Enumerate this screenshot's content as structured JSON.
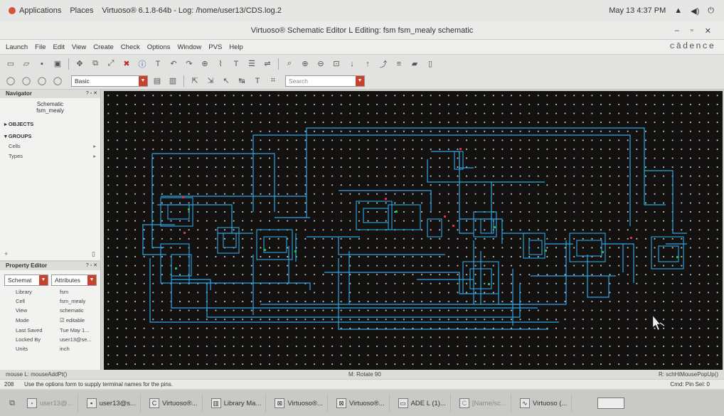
{
  "topbar": {
    "applications": "Applications",
    "places": "Places",
    "app_title": "Virtuoso® 6.1.8-64b - Log: /home/user13/CDS.log.2",
    "clock": "May 13  4:37 PM"
  },
  "window": {
    "title": "Virtuoso® Schematic Editor L Editing: fsm fsm_mealy schematic",
    "brand": "cādence"
  },
  "menubar": [
    "Launch",
    "File",
    "Edit",
    "View",
    "Create",
    "Check",
    "Options",
    "Window",
    "PVS",
    "Help"
  ],
  "toolbar": {
    "workspace_combo": "Basic",
    "search_placeholder": "Search"
  },
  "navigator": {
    "title": "Navigator",
    "view": "Schematic",
    "cell": "fsm_mealy",
    "objects": "OBJECTS",
    "groups": "GROUPS",
    "items": [
      {
        "label": "Cells"
      },
      {
        "label": "Types"
      }
    ]
  },
  "property_editor": {
    "title": "Property Editor",
    "combo1": "Schemat",
    "combo2": "Attributes",
    "rows": [
      {
        "key": "Library",
        "value": "fsm"
      },
      {
        "key": "Cell",
        "value": "fsm_mealy"
      },
      {
        "key": "View",
        "value": "schematic"
      },
      {
        "key": "Mode",
        "value": "editable"
      },
      {
        "key": "Last Saved",
        "value": "Tue May 1..."
      },
      {
        "key": "Locked By",
        "value": "user13@se..."
      },
      {
        "key": "Units",
        "value": "inch"
      }
    ]
  },
  "status": {
    "left": "mouse L: mouseAddPt()",
    "middle": "M: Rotate 90",
    "right": "R: schHiMousePopUp()",
    "line_number": "208",
    "prompt": "Use the options form to supply terminal names for the pins.",
    "cmd": "Cmd: Pin  Sel: 0"
  },
  "taskbar": [
    {
      "label": "user13@...",
      "dim": true
    },
    {
      "label": "user13@s...",
      "dim": false
    },
    {
      "label": "Virtuoso®...",
      "dim": false
    },
    {
      "label": "Library Ma...",
      "dim": false
    },
    {
      "label": "Virtuoso®...",
      "dim": false
    },
    {
      "label": "Virtuoso®...",
      "dim": false
    },
    {
      "label": "ADE L (1)...",
      "dim": false
    },
    {
      "label": "[Name/sc...",
      "dim": true
    },
    {
      "label": "Virtuoso (...",
      "dim": false
    }
  ],
  "colors": {
    "wire": "#2aa6e6",
    "canvas_bg": "#141210",
    "pin_green": "#22c24a",
    "pin_red": "#e0304a"
  }
}
